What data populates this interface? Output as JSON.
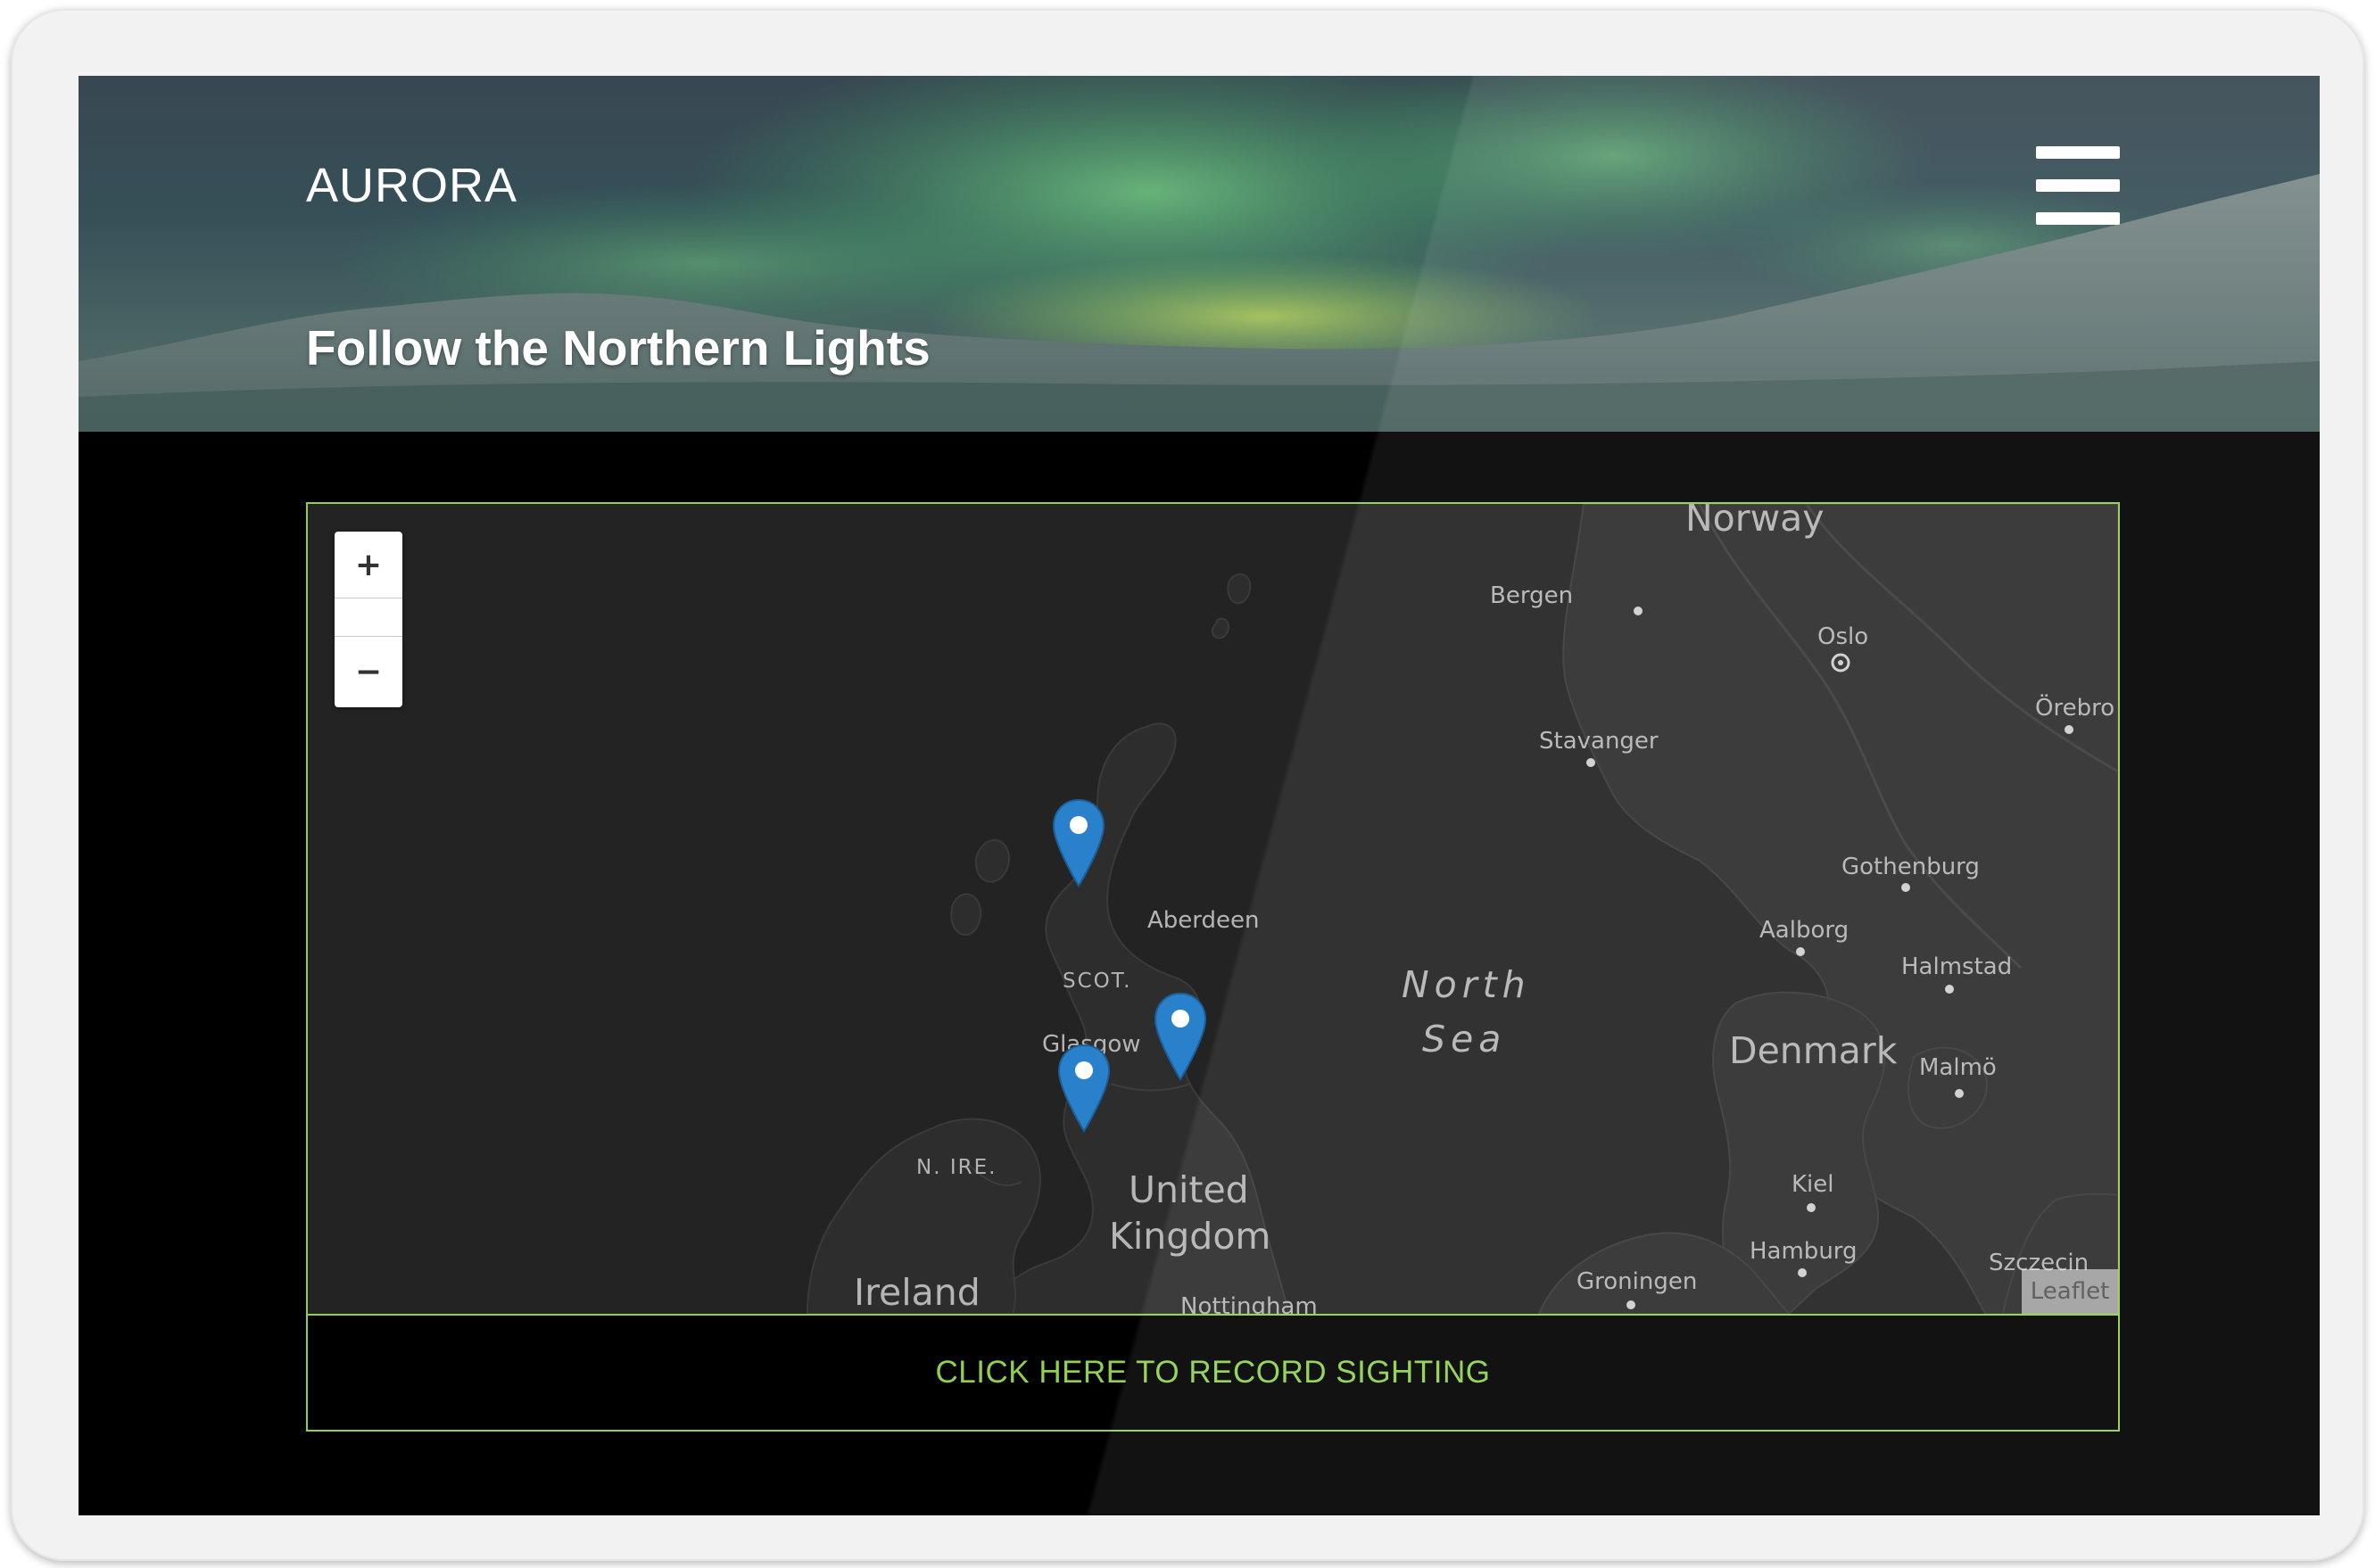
{
  "header": {
    "brand": "AURORA",
    "title": "Follow the Northern Lights",
    "menu_icon": "hamburger-icon"
  },
  "map": {
    "zoom_in_label": "+",
    "zoom_out_label": "−",
    "attribution": "Leaflet",
    "labels": {
      "norway": "Norway",
      "bergen": "Bergen",
      "oslo": "Oslo",
      "orebro": "Örebro",
      "stavanger": "Stavanger",
      "gothenburg": "Gothenburg",
      "aalborg": "Aalborg",
      "halmstad": "Halmstad",
      "aberdeen": "Aberdeen",
      "scot": "SCOT.",
      "glasgow": "Glasgow",
      "north": "North",
      "sea": "Sea",
      "denmark": "Denmark",
      "malmo": "Malmö",
      "kiel": "Kiel",
      "hamburg": "Hamburg",
      "szczecin": "Szczecin",
      "groningen": "Groningen",
      "n_ire": "N. IRE.",
      "united": "United",
      "kingdom": "Kingdom",
      "ireland": "Ireland",
      "nottingham": "Nottingham"
    },
    "markers": [
      {
        "name": "marker-north-scotland"
      },
      {
        "name": "marker-aberdeen"
      },
      {
        "name": "marker-glasgow"
      }
    ],
    "marker_color": "#2a81cb"
  },
  "cta": {
    "label": "CLICK HERE TO RECORD SIGHTING"
  },
  "colors": {
    "accent": "#8fd14f",
    "background": "#000000",
    "map_land": "#2e2e2e",
    "map_water": "#232323"
  }
}
